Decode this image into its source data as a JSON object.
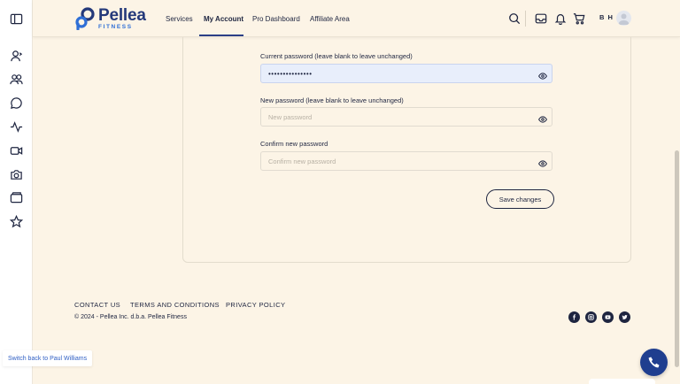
{
  "header": {
    "logo": {
      "name": "Pellea",
      "subtitle": "FITNESS"
    },
    "nav": [
      {
        "label": "Services"
      },
      {
        "label": "My Account"
      },
      {
        "label": "Pro Dashboard"
      },
      {
        "label": "Affiliate Area"
      }
    ],
    "active_nav": "My Account",
    "user_initials": "B H"
  },
  "rail": {
    "icons": [
      "sidebar-toggle-icon",
      "user-icon",
      "users-icon",
      "chat-icon",
      "activity-icon",
      "video-icon",
      "camera-icon",
      "wallet-icon",
      "star-icon"
    ]
  },
  "form": {
    "current_password": {
      "label": "Current password (leave blank to leave unchanged)",
      "value": "•••••••••••••••",
      "placeholder": ""
    },
    "new_password": {
      "label": "New password (leave blank to leave unchanged)",
      "value": "",
      "placeholder": "New password"
    },
    "confirm_password": {
      "label": "Confirm new password",
      "value": "",
      "placeholder": "Confirm new password"
    },
    "save_label": "Save changes"
  },
  "footer": {
    "links": [
      {
        "label": "CONTACT US"
      },
      {
        "label": "TERMS AND CONDITIONS"
      },
      {
        "label": "PRIVACY POLICY"
      }
    ],
    "copyright": "© 2024 - Pellea Inc. d.b.a. Pellea Fitness",
    "social": [
      "facebook-icon",
      "instagram-icon",
      "youtube-icon",
      "twitter-icon"
    ]
  },
  "switch_back": "Switch back to Paul Williams",
  "colors": {
    "brand": "#24397a",
    "accent": "#2f6fd6",
    "background": "#fcf4e6",
    "call_button": "#1f3e8f"
  }
}
